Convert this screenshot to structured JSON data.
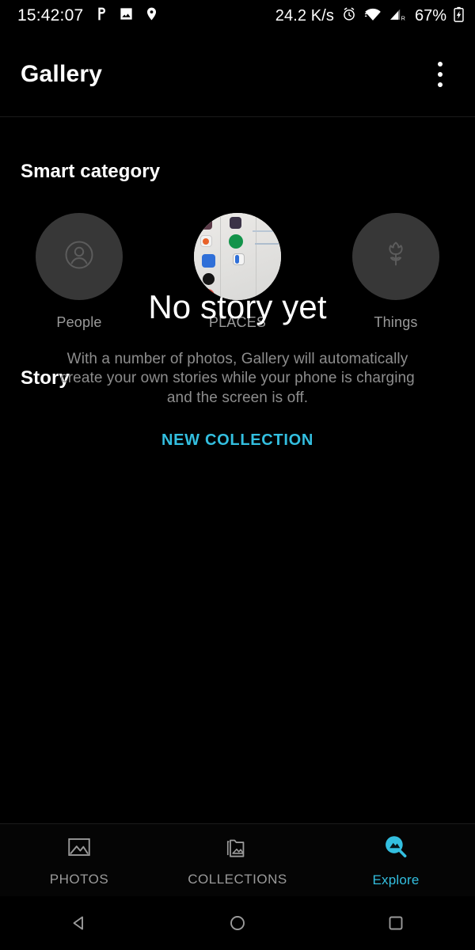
{
  "status_bar": {
    "clock": "15:42:07",
    "left_icons": [
      "pocket-icon",
      "photo-icon",
      "location-pin-icon"
    ],
    "network_speed": "24.2 K/s",
    "right_icons": [
      "alarm-clock-icon",
      "wifi-icon",
      "cellular-signal-icon"
    ],
    "signal_label": "R",
    "battery_percent": "67%",
    "battery_icon": "battery-charging-icon"
  },
  "app_bar": {
    "title": "Gallery",
    "overflow_icon": "overflow-menu-icon"
  },
  "smart_category": {
    "heading": "Smart category",
    "items": [
      {
        "label": "People",
        "icon": "person-circle-icon",
        "type": "icon"
      },
      {
        "label": "PLACES",
        "icon": "photo-thumbnail",
        "type": "thumbnail"
      },
      {
        "label": "Things",
        "icon": "flower-icon",
        "type": "icon"
      }
    ]
  },
  "story": {
    "heading": "Story",
    "empty_title": "No story yet",
    "empty_subtitle": "With a number of photos, Gallery will automatically create your own stories while your phone is charging and the screen is off.",
    "action_label": "NEW COLLECTION"
  },
  "tabs": [
    {
      "label": "PHOTOS",
      "icon": "image-outline-icon",
      "active": false
    },
    {
      "label": "COLLECTIONS",
      "icon": "folder-image-icon",
      "active": false
    },
    {
      "label": "Explore",
      "icon": "explore-search-icon",
      "active": true
    }
  ],
  "system_nav": {
    "back": "back-triangle-icon",
    "home": "home-circle-icon",
    "recents": "recents-square-icon"
  },
  "colors": {
    "accent": "#33bfe0",
    "background": "#000000",
    "secondary_text": "#9a9a9a",
    "circle_fill": "#373737"
  }
}
